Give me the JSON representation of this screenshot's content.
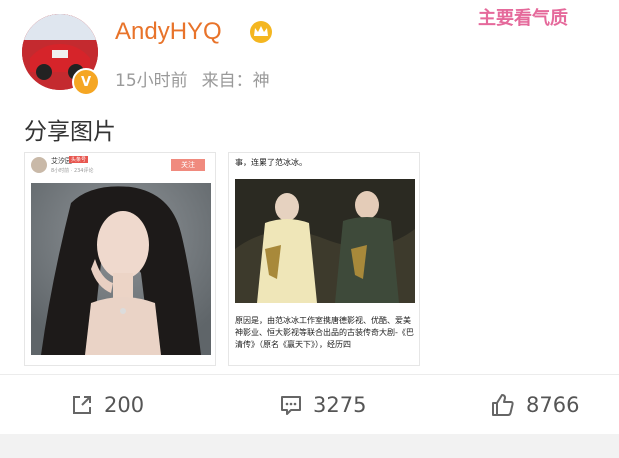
{
  "post": {
    "username": "AndyHYQ",
    "time": "15小时前",
    "source": "来自：神",
    "text": "分享图片",
    "tag": "主要看气质"
  },
  "card1": {
    "name": "艾汐园",
    "badge": "头条号",
    "time": "8小时前 · 234评论",
    "follow": "关注"
  },
  "card2": {
    "top_text": "事，连累了范冰冰。",
    "body_text": "原因是，由范冰冰工作室携唐德影视、优酷、爱美神影业、恒大影视等联合出品的古装传奇大剧-《巴清传》（原名《赢天下》），经历四"
  },
  "actions": {
    "repost": "200",
    "comment": "3275",
    "like": "8766"
  },
  "icons": [
    "share-icon",
    "comment-icon",
    "thumbs-up-icon",
    "crown-icon",
    "verified-icon"
  ],
  "colors": {
    "username": "#e8732a",
    "tag": "#e5699b",
    "badge": "#f5a623"
  }
}
